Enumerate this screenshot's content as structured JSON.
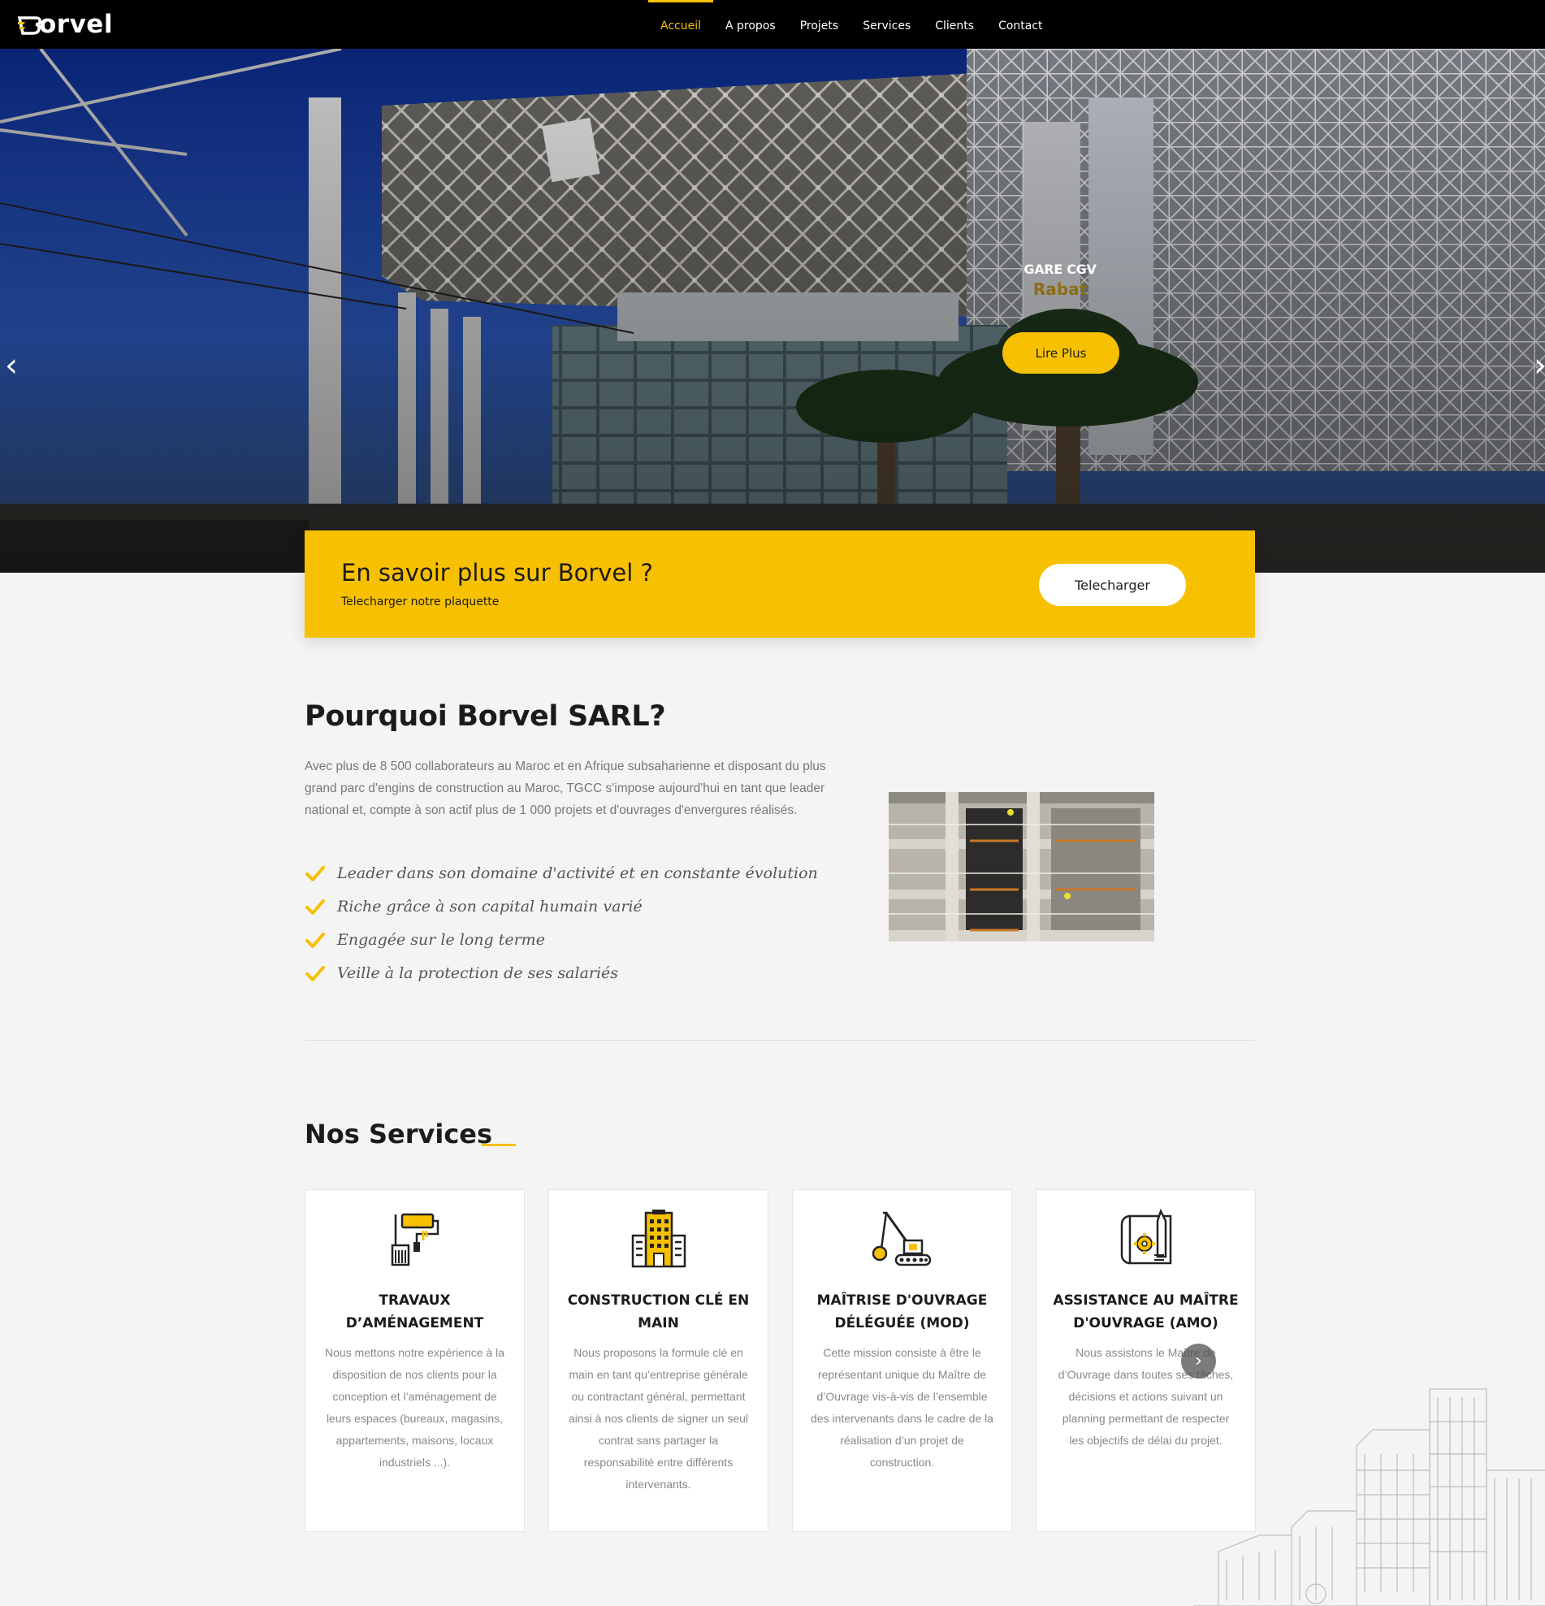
{
  "brand": {
    "name": "orvel",
    "mark": "B",
    "accent": "#f7c000"
  },
  "nav": {
    "items": [
      "Accueil",
      "A propos",
      "Projets",
      "Services",
      "Clients",
      "Contact"
    ],
    "active": "Accueil"
  },
  "hero": {
    "title": "GARE CGV",
    "subtitle": "Rabat",
    "button": "Lire Plus",
    "prev_icon": "chevron-left-icon",
    "next_icon": "chevron-right-icon"
  },
  "cta": {
    "title": "En savoir plus sur Borvel ?",
    "subtitle": "Telecharger notre plaquette",
    "button": "Telecharger"
  },
  "why": {
    "title": "Pourquoi Borvel SARL?",
    "text": "Avec plus de 8 500 collaborateurs au Maroc et en Afrique subsaharienne et disposant du plus grand parc d'engins de construction au Maroc, TGCC s'impose aujourd'hui en tant que leader national et, compte à son actif plus de 1 000 projets et d'ouvrages d'envergures réalisés.",
    "points": [
      "Leader dans son domaine d'activité et en constante évolution",
      "Riche grâce à son capital humain varié",
      "Engagée sur le long terme",
      "Veille à la protection de ses salariés"
    ]
  },
  "services": {
    "title": "Nos Services",
    "cards": [
      {
        "icon": "paint-roller-icon",
        "title": "TRAVAUX D’AMÉNAGEMENT",
        "text": "Nous mettons notre expérience à la disposition de nos clients pour la conception et l’aménagement de leurs espaces (bureaux, magasins, appartements, maisons, locaux industriels ...)."
      },
      {
        "icon": "building-icon",
        "title": "CONSTRUCTION CLÉ EN MAIN",
        "text": "Nous proposons la formule clé en main en tant qu’entreprise générale ou contractant général, permettant ainsi à nos clients de signer un seul contrat sans partager la responsabilité entre différents intervenants."
      },
      {
        "icon": "excavator-icon",
        "title": "MAÎTRISE D'OUVRAGE DÉLÉGUÉE (MOD)",
        "text": "Cette mission consiste à être le représentant unique du Maître de d’Ouvrage vis-à-vis de l’ensemble des intervenants dans le cadre de la réalisation d’un projet de construction."
      },
      {
        "icon": "blueprint-gear-icon",
        "title": "ASSISTANCE AU MAÎTRE D'OUVRAGE (AMO)",
        "text": "Nous assistons le Maître de d’Ouvrage dans toutes ses tâches, décisions et actions suivant un planning permettant de respecter les objectifs de délai du projet."
      }
    ],
    "next_icon": "chevron-right-icon"
  }
}
